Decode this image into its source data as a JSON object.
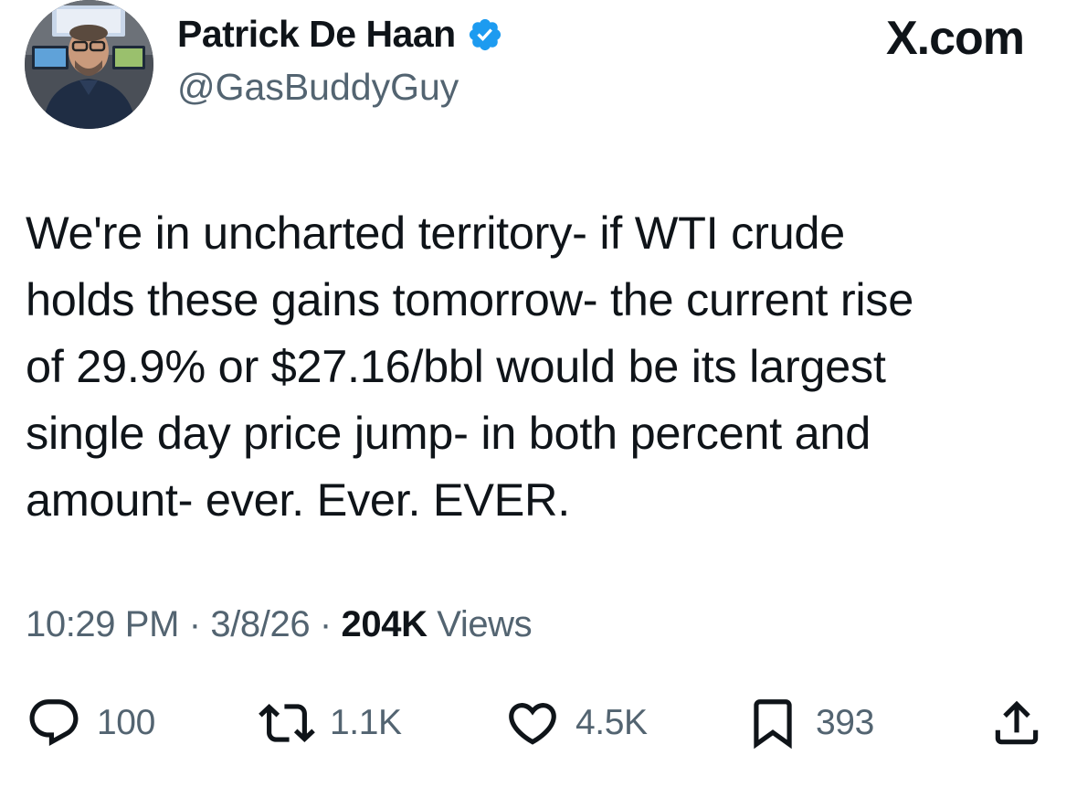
{
  "author": {
    "display_name": "Patrick De Haan",
    "handle": "@GasBuddyGuy",
    "verified": true
  },
  "brand": "X.com",
  "tweet": {
    "lines": [
      "We're in uncharted territory- if WTI crude",
      "holds these gains tomorrow- the current rise",
      "of 29.9% or $27.16/bbl would be its largest",
      "single day price jump- in both percent and",
      "amount- ever. Ever. EVER."
    ]
  },
  "meta": {
    "time": "10:29 PM",
    "separator": "·",
    "date": "3/8/26",
    "views_count": "204K",
    "views_label": "Views"
  },
  "actions": {
    "replies": "100",
    "reposts": "1.1K",
    "likes": "4.5K",
    "bookmarks": "393"
  },
  "colors": {
    "text": "#0f1419",
    "secondary": "#536471",
    "verified": "#1d9bf0"
  }
}
